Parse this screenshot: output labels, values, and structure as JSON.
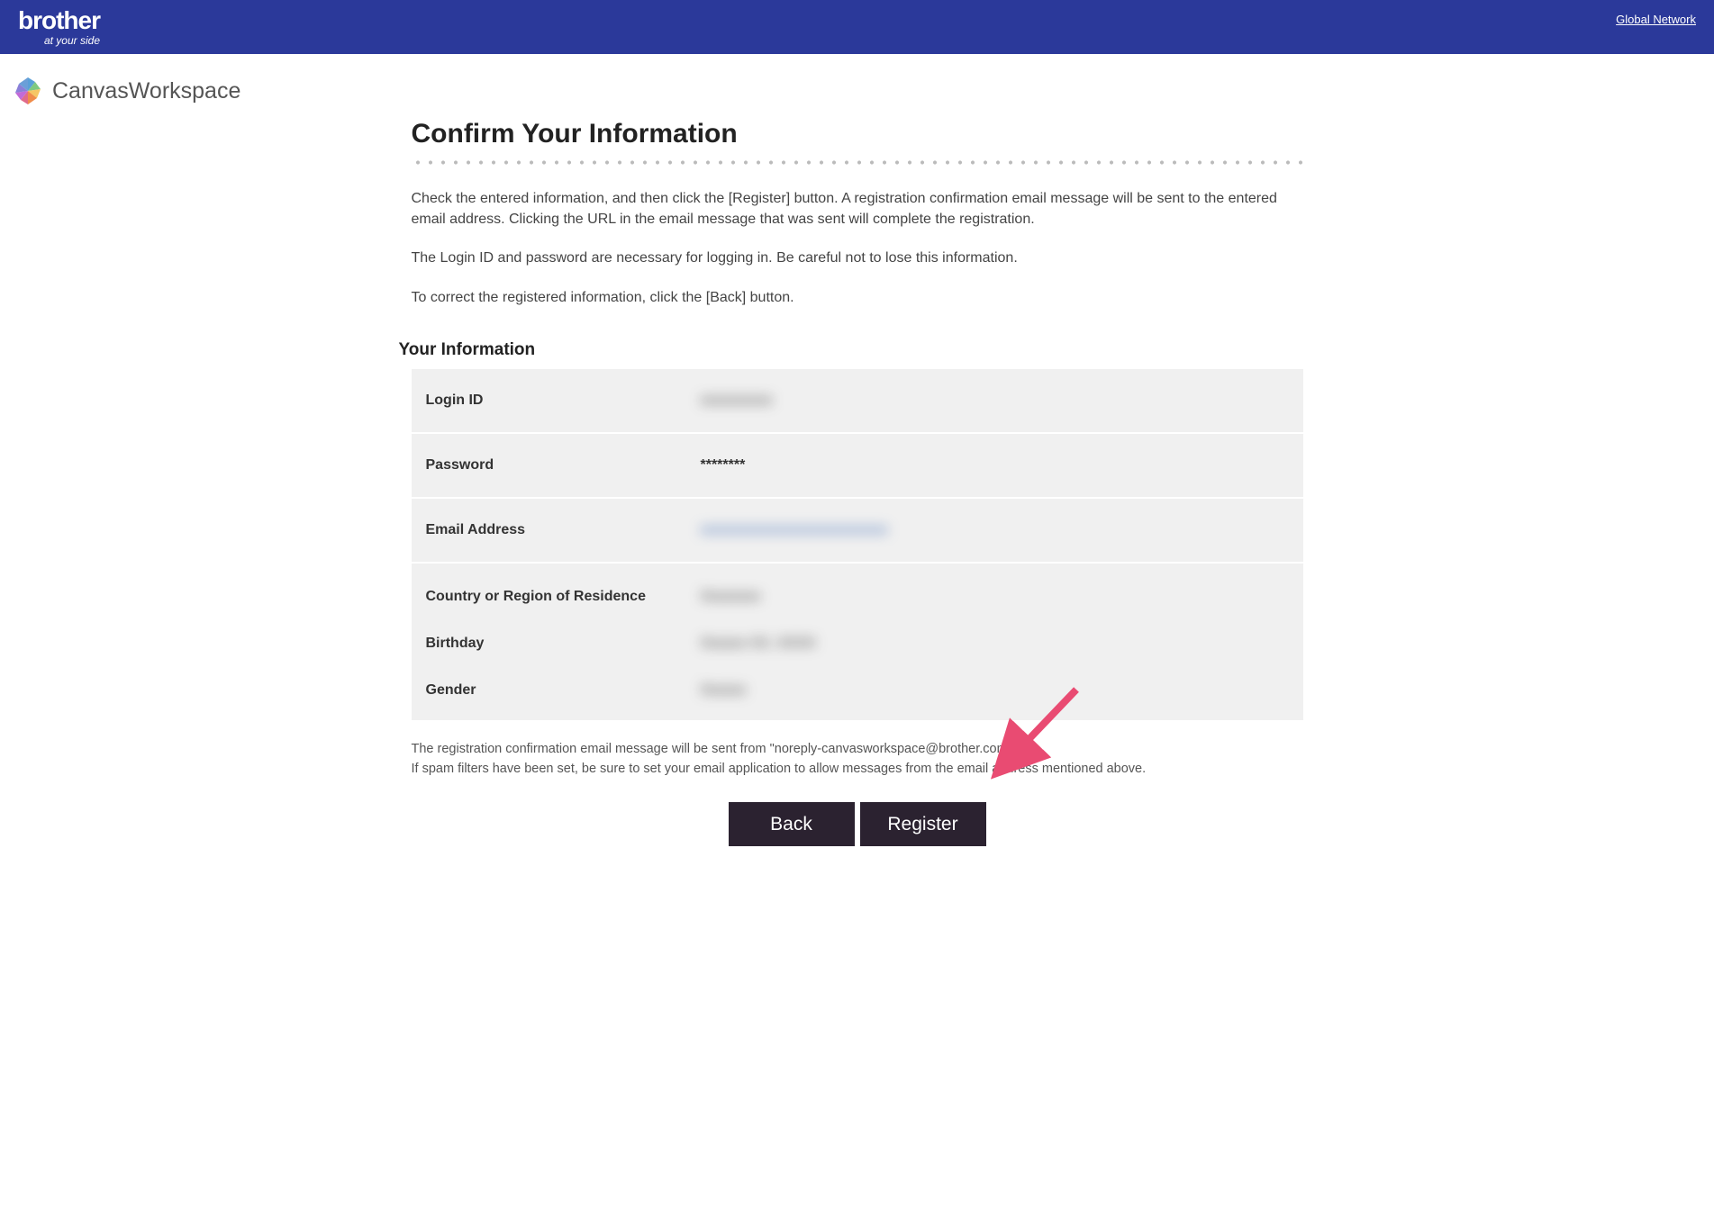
{
  "header": {
    "brand": "brother",
    "tagline": "at your side",
    "global_link": "Global Network"
  },
  "app": {
    "name": "CanvasWorkspace"
  },
  "page": {
    "title": "Confirm Your Information",
    "instruction1": "Check the entered information, and then click the [Register] button. A registration confirmation email message will be sent to the entered email address. Clicking the URL in the email message that was sent will complete the registration.",
    "instruction2": "The Login ID and password are necessary for logging in. Be careful not to lose this information.",
    "instruction3": "To correct the registered information, click the [Back] button."
  },
  "section": {
    "title": "Your Information"
  },
  "fields": {
    "login_id": {
      "label": "Login ID",
      "value": "xxxxxxxxxx"
    },
    "password": {
      "label": "Password",
      "value": "********"
    },
    "email": {
      "label": "Email Address",
      "value": "xxxxxxxxxxxxxxxxxxxxxxxxxx"
    },
    "country": {
      "label": "Country or Region of Residence",
      "value": "Xxxxxxxx"
    },
    "birthday": {
      "label": "Birthday",
      "value": "Xxxxxx XX, XXXX"
    },
    "gender": {
      "label": "Gender",
      "value": "Xxxxxx"
    }
  },
  "footnote": {
    "line1": "The registration confirmation email message will be sent from \"noreply-canvasworkspace@brother.com\".",
    "line2": "If spam filters have been set, be sure to set your email application to allow messages from the email address mentioned above."
  },
  "buttons": {
    "back": "Back",
    "register": "Register"
  }
}
